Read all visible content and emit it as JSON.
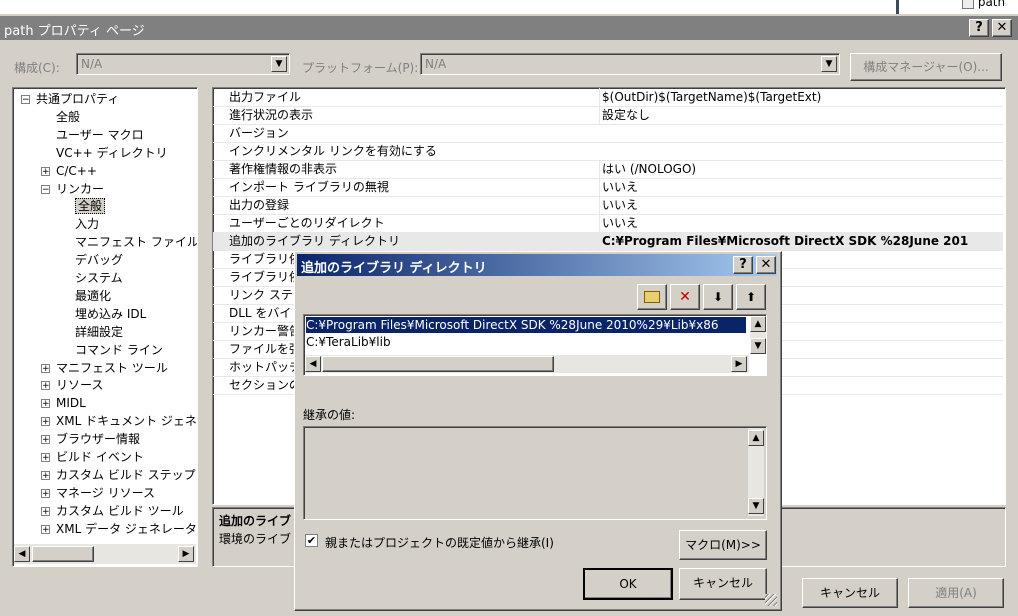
{
  "window": {
    "title": "path プロパティ ページ",
    "help": "?",
    "close": "✕"
  },
  "top_right_item": {
    "label": "path"
  },
  "config_bar": {
    "config_label": "構成(C):",
    "config_value": "N/A",
    "platform_label": "プラットフォーム(P):",
    "platform_value": "N/A",
    "manager_button": "構成マネージャー(O)..."
  },
  "tree": [
    {
      "label": "共通プロパティ",
      "expander": "⊟",
      "level": 0
    },
    {
      "label": "全般",
      "expander": "",
      "level": 1
    },
    {
      "label": "ユーザー マクロ",
      "expander": "",
      "level": 1
    },
    {
      "label": "VC++ ディレクトリ",
      "expander": "",
      "level": 1
    },
    {
      "label": "C/C++",
      "expander": "⊞",
      "level": 1
    },
    {
      "label": "リンカー",
      "expander": "⊟",
      "level": 1
    },
    {
      "label": "全般",
      "expander": "",
      "level": 2,
      "selected": true
    },
    {
      "label": "入力",
      "expander": "",
      "level": 2
    },
    {
      "label": "マニフェスト ファイル",
      "expander": "",
      "level": 2
    },
    {
      "label": "デバッグ",
      "expander": "",
      "level": 2
    },
    {
      "label": "システム",
      "expander": "",
      "level": 2
    },
    {
      "label": "最適化",
      "expander": "",
      "level": 2
    },
    {
      "label": "埋め込み IDL",
      "expander": "",
      "level": 2
    },
    {
      "label": "詳細設定",
      "expander": "",
      "level": 2
    },
    {
      "label": "コマンド ライン",
      "expander": "",
      "level": 2
    },
    {
      "label": "マニフェスト ツール",
      "expander": "⊞",
      "level": 1
    },
    {
      "label": "リソース",
      "expander": "⊞",
      "level": 1
    },
    {
      "label": "MIDL",
      "expander": "⊞",
      "level": 1
    },
    {
      "label": "XML ドキュメント ジェネレ",
      "expander": "⊞",
      "level": 1
    },
    {
      "label": "ブラウザー情報",
      "expander": "⊞",
      "level": 1
    },
    {
      "label": "ビルド イベント",
      "expander": "⊞",
      "level": 1
    },
    {
      "label": "カスタム ビルド ステップ",
      "expander": "⊞",
      "level": 1
    },
    {
      "label": "マネージ リソース",
      "expander": "⊞",
      "level": 1
    },
    {
      "label": "カスタム ビルド ツール",
      "expander": "⊞",
      "level": 1
    },
    {
      "label": "XML データ ジェネレータ",
      "expander": "⊞",
      "level": 1
    }
  ],
  "grid": [
    {
      "name": "出力ファイル",
      "value": "$(OutDir)$(TargetName)$(TargetExt)"
    },
    {
      "name": "進行状況の表示",
      "value": "設定なし"
    },
    {
      "name": "バージョン",
      "value": ""
    },
    {
      "name": "インクリメンタル リンクを有効にする",
      "value": ""
    },
    {
      "name": "著作権情報の非表示",
      "value": "はい (/NOLOGO)"
    },
    {
      "name": "インポート ライブラリの無視",
      "value": "いいえ"
    },
    {
      "name": "出力の登録",
      "value": "いいえ"
    },
    {
      "name": "ユーザーごとのリダイレクト",
      "value": "いいえ"
    },
    {
      "name": "追加のライブラリ ディレクトリ",
      "value": "C:¥Program Files¥Microsoft DirectX SDK %28June 201",
      "bold": true,
      "selected": true
    },
    {
      "name": "ライブラリ依",
      "value": ""
    },
    {
      "name": "ライブラリ依",
      "value": ""
    },
    {
      "name": "リンク ステー",
      "value": ""
    },
    {
      "name": "DLL をバイ",
      "value": ""
    },
    {
      "name": "リンカー警告",
      "value": ""
    },
    {
      "name": "ファイルを強",
      "value": ""
    },
    {
      "name": "ホットパッチ",
      "value": ""
    },
    {
      "name": "セクションの",
      "value": ""
    }
  ],
  "description": {
    "title": "追加のライブ",
    "text": "環境のライブ"
  },
  "main_buttons": {
    "cancel": "キャンセル",
    "apply": "適用(A)"
  },
  "dialog": {
    "title": "追加のライブラリ ディレクトリ",
    "help": "?",
    "close": "✕",
    "toolbar": {
      "new_folder": "new-folder-icon",
      "delete": "✕",
      "down": "⬇",
      "up": "⬆"
    },
    "paths": [
      "C:¥Program Files¥Microsoft DirectX SDK %28June 2010%29¥Lib¥x86",
      "C:¥TeraLib¥lib"
    ],
    "inherited_label": "継承の値:",
    "inherit_checkbox_label": "親またはプロジェクトの既定値から継承(I)",
    "inherit_checked": true,
    "macro_button": "マクロ(M)>>",
    "ok_button": "OK",
    "cancel_button": "キャンセル"
  }
}
